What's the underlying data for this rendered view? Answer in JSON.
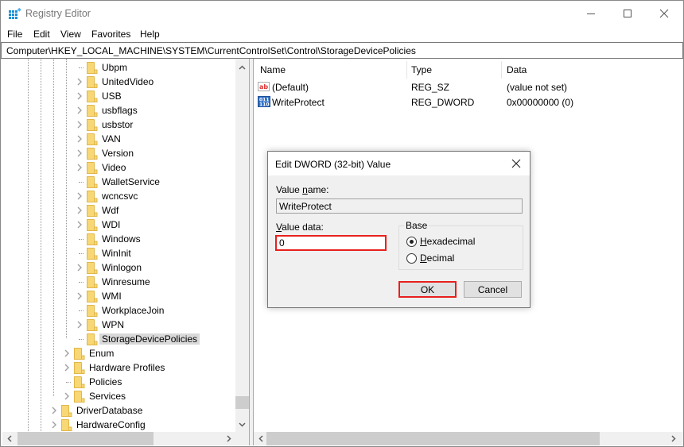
{
  "window": {
    "title": "Registry Editor",
    "controls": {
      "minimize": "minimize",
      "maximize": "maximize",
      "close": "close"
    }
  },
  "menu": [
    "File",
    "Edit",
    "View",
    "Favorites",
    "Help"
  ],
  "address": "Computer\\HKEY_LOCAL_MACHINE\\SYSTEM\\CurrentControlSet\\Control\\StorageDevicePolicies",
  "tree": {
    "items": [
      {
        "label": "Ubpm",
        "expandable": false,
        "level": 3
      },
      {
        "label": "UnitedVideo",
        "expandable": true,
        "level": 3
      },
      {
        "label": "USB",
        "expandable": true,
        "level": 3
      },
      {
        "label": "usbflags",
        "expandable": true,
        "level": 3
      },
      {
        "label": "usbstor",
        "expandable": true,
        "level": 3
      },
      {
        "label": "VAN",
        "expandable": true,
        "level": 3
      },
      {
        "label": "Version",
        "expandable": true,
        "level": 3
      },
      {
        "label": "Video",
        "expandable": true,
        "level": 3
      },
      {
        "label": "WalletService",
        "expandable": false,
        "level": 3
      },
      {
        "label": "wcncsvc",
        "expandable": true,
        "level": 3
      },
      {
        "label": "Wdf",
        "expandable": true,
        "level": 3
      },
      {
        "label": "WDI",
        "expandable": true,
        "level": 3
      },
      {
        "label": "Windows",
        "expandable": false,
        "level": 3
      },
      {
        "label": "WinInit",
        "expandable": false,
        "level": 3
      },
      {
        "label": "Winlogon",
        "expandable": true,
        "level": 3
      },
      {
        "label": "Winresume",
        "expandable": false,
        "level": 3
      },
      {
        "label": "WMI",
        "expandable": true,
        "level": 3
      },
      {
        "label": "WorkplaceJoin",
        "expandable": false,
        "level": 3
      },
      {
        "label": "WPN",
        "expandable": true,
        "level": 3
      },
      {
        "label": "StorageDevicePolicies",
        "expandable": false,
        "level": 3,
        "selected": true
      },
      {
        "label": "Enum",
        "expandable": true,
        "level": 2
      },
      {
        "label": "Hardware Profiles",
        "expandable": true,
        "level": 2
      },
      {
        "label": "Policies",
        "expandable": false,
        "level": 2
      },
      {
        "label": "Services",
        "expandable": true,
        "level": 2
      },
      {
        "label": "DriverDatabase",
        "expandable": true,
        "level": 1
      },
      {
        "label": "HardwareConfig",
        "expandable": true,
        "level": 1
      }
    ]
  },
  "list": {
    "columns": [
      "Name",
      "Type",
      "Data"
    ],
    "rows": [
      {
        "icon": "string-value-icon",
        "name": "(Default)",
        "type": "REG_SZ",
        "data": "(value not set)"
      },
      {
        "icon": "binary-value-icon",
        "name": "WriteProtect",
        "type": "REG_DWORD",
        "data": "0x00000000 (0)"
      }
    ]
  },
  "dialog": {
    "title": "Edit DWORD (32-bit) Value",
    "value_name_label_pre": "Value ",
    "value_name_label_u": "n",
    "value_name_label_post": "ame:",
    "value_name": "WriteProtect",
    "value_data_label_u": "V",
    "value_data_label_post": "alue data:",
    "value_data": "0",
    "base_label": "Base",
    "hex_u": "H",
    "hex_post": "exadecimal",
    "dec_u": "D",
    "dec_post": "ecimal",
    "selected_base": "Hexadecimal",
    "ok": "OK",
    "cancel": "Cancel",
    "highlight_color": "#e8201e"
  }
}
